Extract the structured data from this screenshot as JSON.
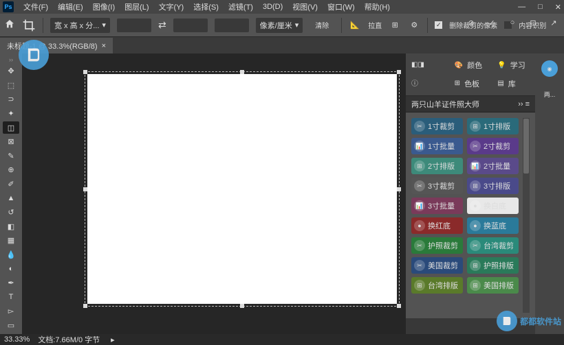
{
  "menu": {
    "items": [
      "文件(F)",
      "编辑(E)",
      "图像(I)",
      "图层(L)",
      "文字(Y)",
      "选择(S)",
      "滤镜(T)",
      "3D(D)",
      "视图(V)",
      "窗口(W)",
      "帮助(H)"
    ]
  },
  "toolbar": {
    "ratio": "宽 x 高 x 分...",
    "unit": "像素/厘米",
    "clear": "清除",
    "straighten": "拉直",
    "del_cropped": "删除裁剪的像素",
    "content_aware": "内容识别"
  },
  "tab": {
    "title": "未标题-1 @ 33.3%(RGB/8)"
  },
  "rtop": {
    "color": "颜色",
    "swatch": "色板",
    "learn": "学习",
    "lib": "库"
  },
  "panel": {
    "title": "两只山羊证件照大师"
  },
  "buttons": {
    "left": [
      {
        "label": "1寸裁剪",
        "bg": "#2a5d7a",
        "icon": "✂"
      },
      {
        "label": "1寸批量",
        "bg": "#3a5a8f",
        "icon": "📊"
      },
      {
        "label": "2寸排版",
        "bg": "#3d8a7a",
        "icon": "⊞"
      },
      {
        "label": "3寸裁剪",
        "bg": "#555",
        "icon": "✂"
      },
      {
        "label": "3寸批量",
        "bg": "#7a3a5a",
        "icon": "📊"
      },
      {
        "label": "换红底",
        "bg": "#8a2a2a",
        "icon": "●"
      },
      {
        "label": "护照裁剪",
        "bg": "#2a7a3a",
        "icon": "✂"
      },
      {
        "label": "美国裁剪",
        "bg": "#2a4a7a",
        "icon": "✂"
      },
      {
        "label": "台湾排版",
        "bg": "#5a7a2a",
        "icon": "⊞"
      }
    ],
    "right": [
      {
        "label": "1寸排版",
        "bg": "#2a6a7a",
        "icon": "⊞"
      },
      {
        "label": "2寸裁剪",
        "bg": "#5a3a8a",
        "icon": "✂"
      },
      {
        "label": "2寸批量",
        "bg": "#5a4a8a",
        "icon": "📊"
      },
      {
        "label": "3寸排版",
        "bg": "#4a4a8a",
        "icon": "⊞"
      },
      {
        "label": "换白底",
        "bg": "#e8e8e8",
        "icon": "●",
        "dark": true
      },
      {
        "label": "换蓝底",
        "bg": "#2a7a9a",
        "icon": "●"
      },
      {
        "label": "台湾裁剪",
        "bg": "#2a8a7a",
        "icon": "✂"
      },
      {
        "label": "护照排版",
        "bg": "#2a7a5a",
        "icon": "⊞"
      },
      {
        "label": "美国排版",
        "bg": "#4a8a4a",
        "icon": "⊞"
      }
    ]
  },
  "rtabs": {
    "label": "两..."
  },
  "status": {
    "zoom": "33.33%",
    "doc": "文档:7.66M/0 字节"
  },
  "wm": "都都软件站"
}
